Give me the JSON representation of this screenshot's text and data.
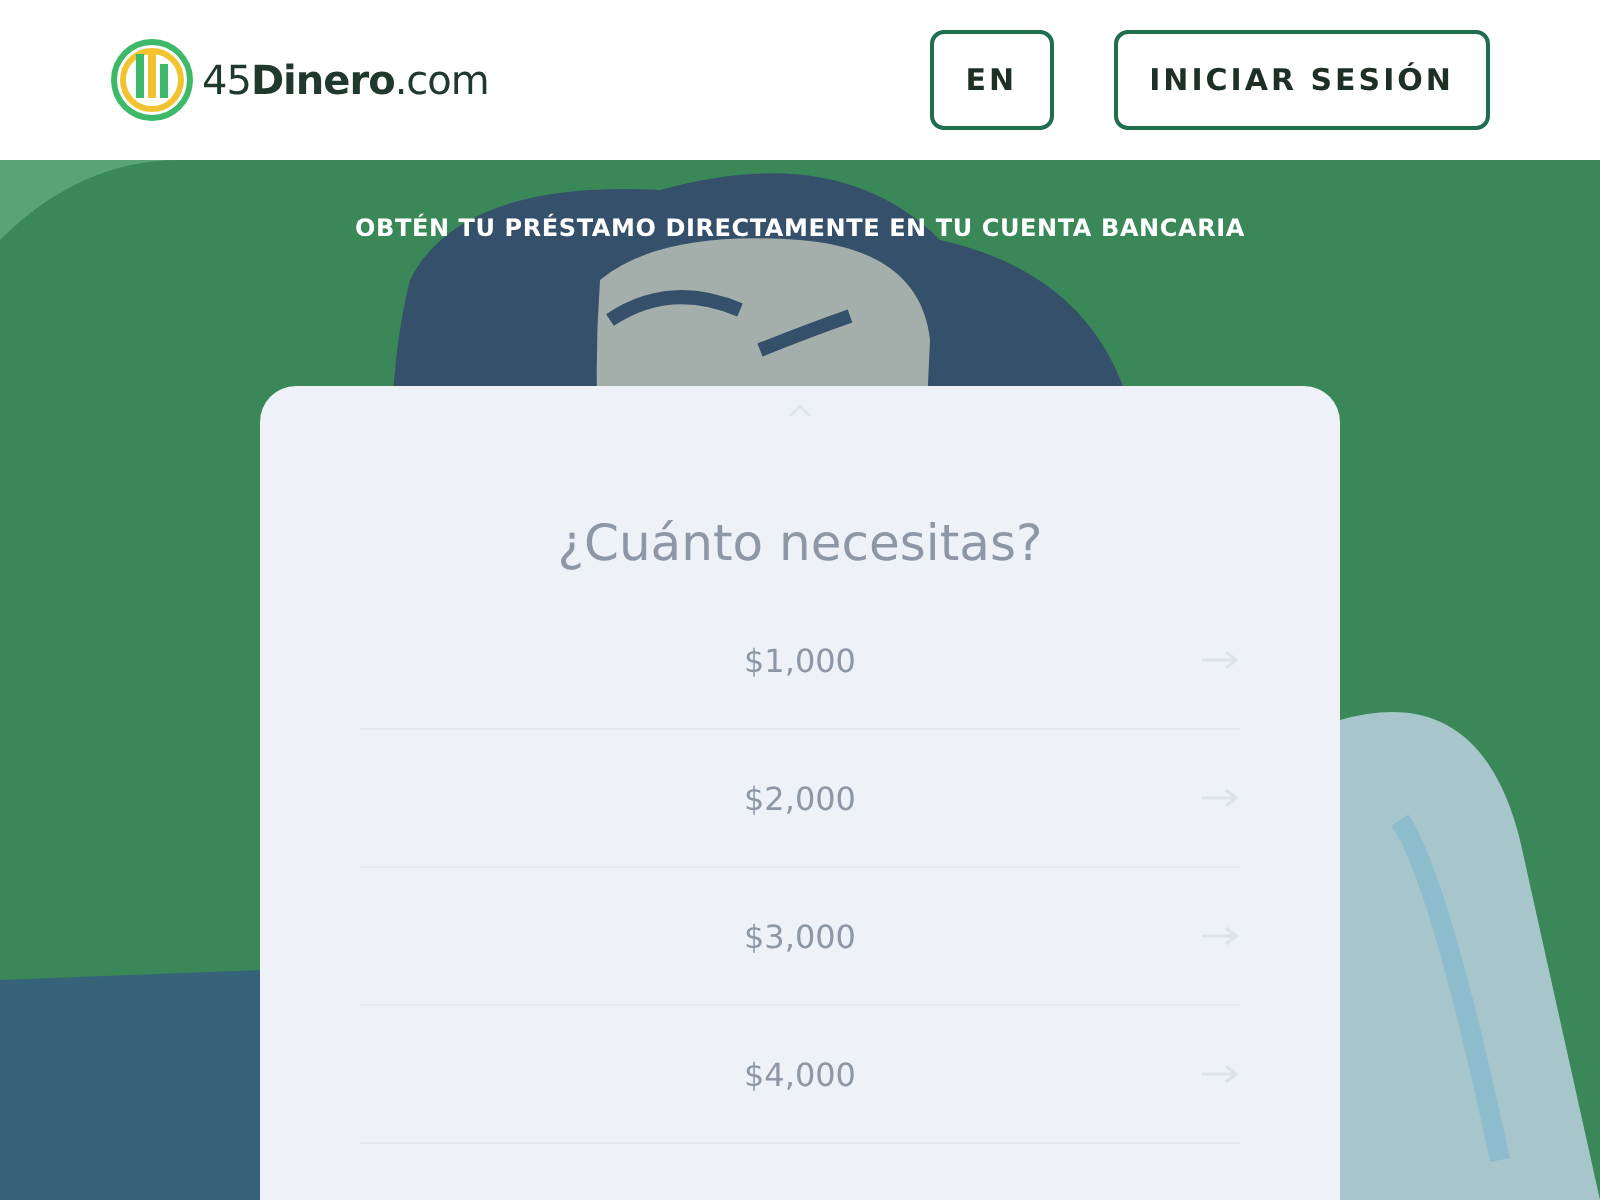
{
  "header": {
    "logo": "45**Dinero**.com",
    "language_button": "EN",
    "login_button": "INICIAR SESIÓN"
  },
  "banner": {
    "tagline": "OBTÉN TU PRÉSTAMO DIRECTAMENTE EN TU CUENTA BANCARIA"
  },
  "card": {
    "question": "¿Cuánto necesitas?",
    "amounts": [
      {
        "label": "$1,000"
      },
      {
        "label": "$2,000"
      },
      {
        "label": "$3,000"
      },
      {
        "label": "$4,000"
      }
    ]
  }
}
